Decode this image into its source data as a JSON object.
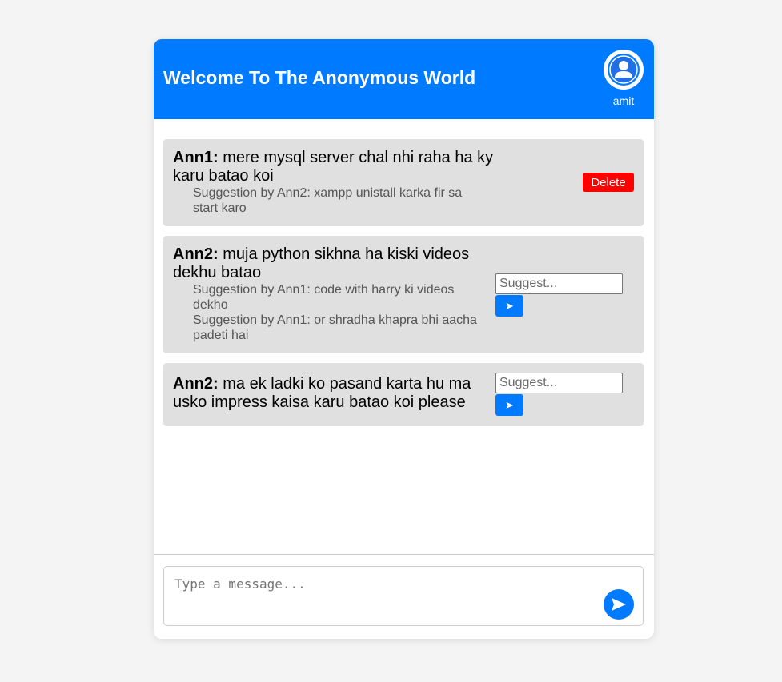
{
  "header": {
    "title": "Welcome To The Anonymous World",
    "username": "amit",
    "accent_color": "#007bff"
  },
  "messages": [
    {
      "author": "Ann1:",
      "text": "mere mysql server chal nhi raha ha ky karu batao koi",
      "suggestions": [
        "Suggestion by Ann2: xampp unistall karka fir sa start karo"
      ],
      "action": {
        "type": "delete",
        "label": "Delete"
      }
    },
    {
      "author": "Ann2:",
      "text": "muja python sikhna ha kiski videos dekhu batao",
      "suggestions": [
        "Suggestion by Ann1: code with harry ki videos dekho",
        "Suggestion by Ann1: or shradha khapra bhi aacha padeti hai"
      ],
      "action": {
        "type": "suggest",
        "placeholder": "Suggest...",
        "send_icon": "send-arrow-icon",
        "send_glyph": "➤"
      }
    },
    {
      "author": "Ann2:",
      "text": "ma ek ladki ko pasand karta hu ma usko impress kaisa karu batao koi please",
      "suggestions": [],
      "action": {
        "type": "suggest",
        "placeholder": "Suggest...",
        "send_icon": "send-arrow-icon",
        "send_glyph": "➤"
      }
    }
  ],
  "composer": {
    "placeholder": "Type a message...",
    "send_icon": "send-icon"
  },
  "colors": {
    "page_bg": "#f4f4f4",
    "message_bg": "#e0e0e0",
    "delete": "#ff0000",
    "suggestion_text": "#555555"
  }
}
